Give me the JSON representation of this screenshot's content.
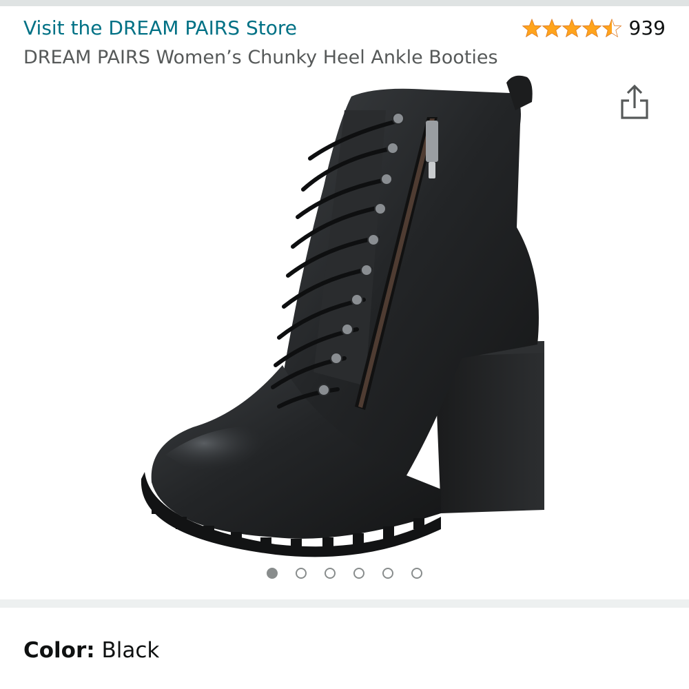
{
  "header": {
    "store_link": "Visit the DREAM PAIRS Store",
    "rating": {
      "stars": 4.5,
      "count": "939",
      "star_color": "#ffa41c"
    },
    "title": "DREAM PAIRS Women’s Chunky Heel Ankle Booties",
    "share_icon": "share-icon"
  },
  "gallery": {
    "image_count": 6,
    "active_index": 0,
    "image_icon": "black-ankle-boot"
  },
  "variation": {
    "color_label": "Color:",
    "color_value": "Black"
  },
  "colors": {
    "link": "#007185",
    "text_primary": "#0f1111",
    "text_secondary": "#565959",
    "divider": "#edf0f0"
  }
}
